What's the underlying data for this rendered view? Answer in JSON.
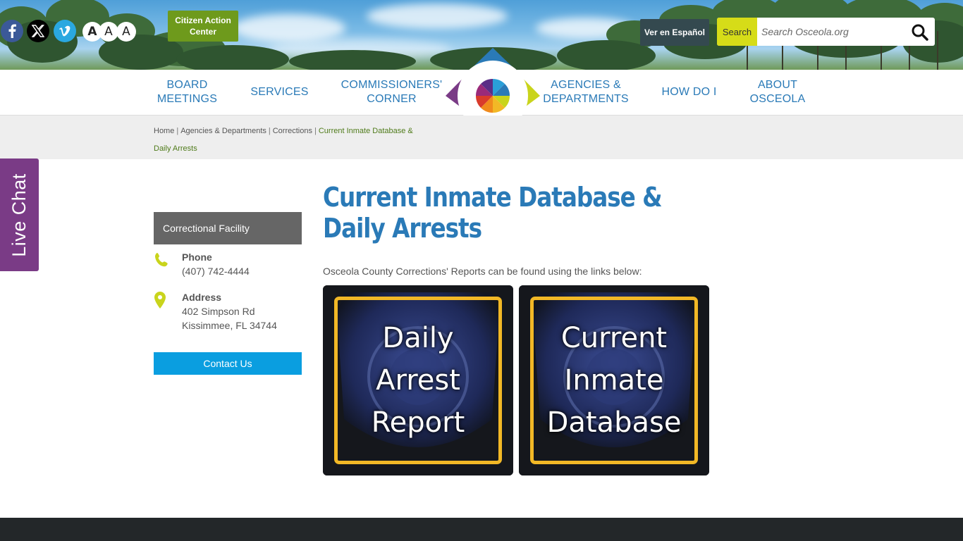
{
  "header": {
    "citizen_action": "Citizen Action Center",
    "font_sizes": [
      "A",
      "A",
      "A"
    ],
    "spanish": "Ver en Español",
    "search": {
      "label": "Search",
      "placeholder": "Search Osceola.org"
    }
  },
  "nav": {
    "items": [
      {
        "label": "BOARD MEETINGS"
      },
      {
        "label": "SERVICES"
      },
      {
        "label": "COMMISSIONERS' CORNER"
      },
      {
        "label": "AGENCIES & DEPARTMENTS"
      },
      {
        "label": "HOW DO I"
      },
      {
        "label": "ABOUT OSCEOLA"
      }
    ]
  },
  "breadcrumb": {
    "items": [
      "Home",
      "Agencies & Departments",
      "Corrections"
    ],
    "current": "Current Inmate Database & Daily Arrests"
  },
  "live_chat": "Live Chat",
  "sidebar": {
    "title": "Correctional Facility",
    "phone_label": "Phone",
    "phone": "(407) 742-4444",
    "address_label": "Address",
    "address_line1": "402 Simpson Rd",
    "address_line2": "Kissimmee, FL 34744",
    "contact_button": "Contact Us"
  },
  "main": {
    "title": "Current Inmate Database & Daily Arrests",
    "intro": "Osceola County Corrections' Reports can be found using the links below:",
    "tiles": [
      {
        "lines": [
          "Daily",
          "Arrest",
          "Report"
        ]
      },
      {
        "lines": [
          "Current",
          "Inmate",
          "Database"
        ]
      }
    ]
  },
  "colors": {
    "link_blue": "#2a7ab7",
    "brand_green": "#6e9a1c",
    "search_yellow": "#d6dc18",
    "live_chat_purple": "#7a3b86",
    "contact_blue": "#0a9ee0",
    "tile_frame": "#f2b826"
  }
}
